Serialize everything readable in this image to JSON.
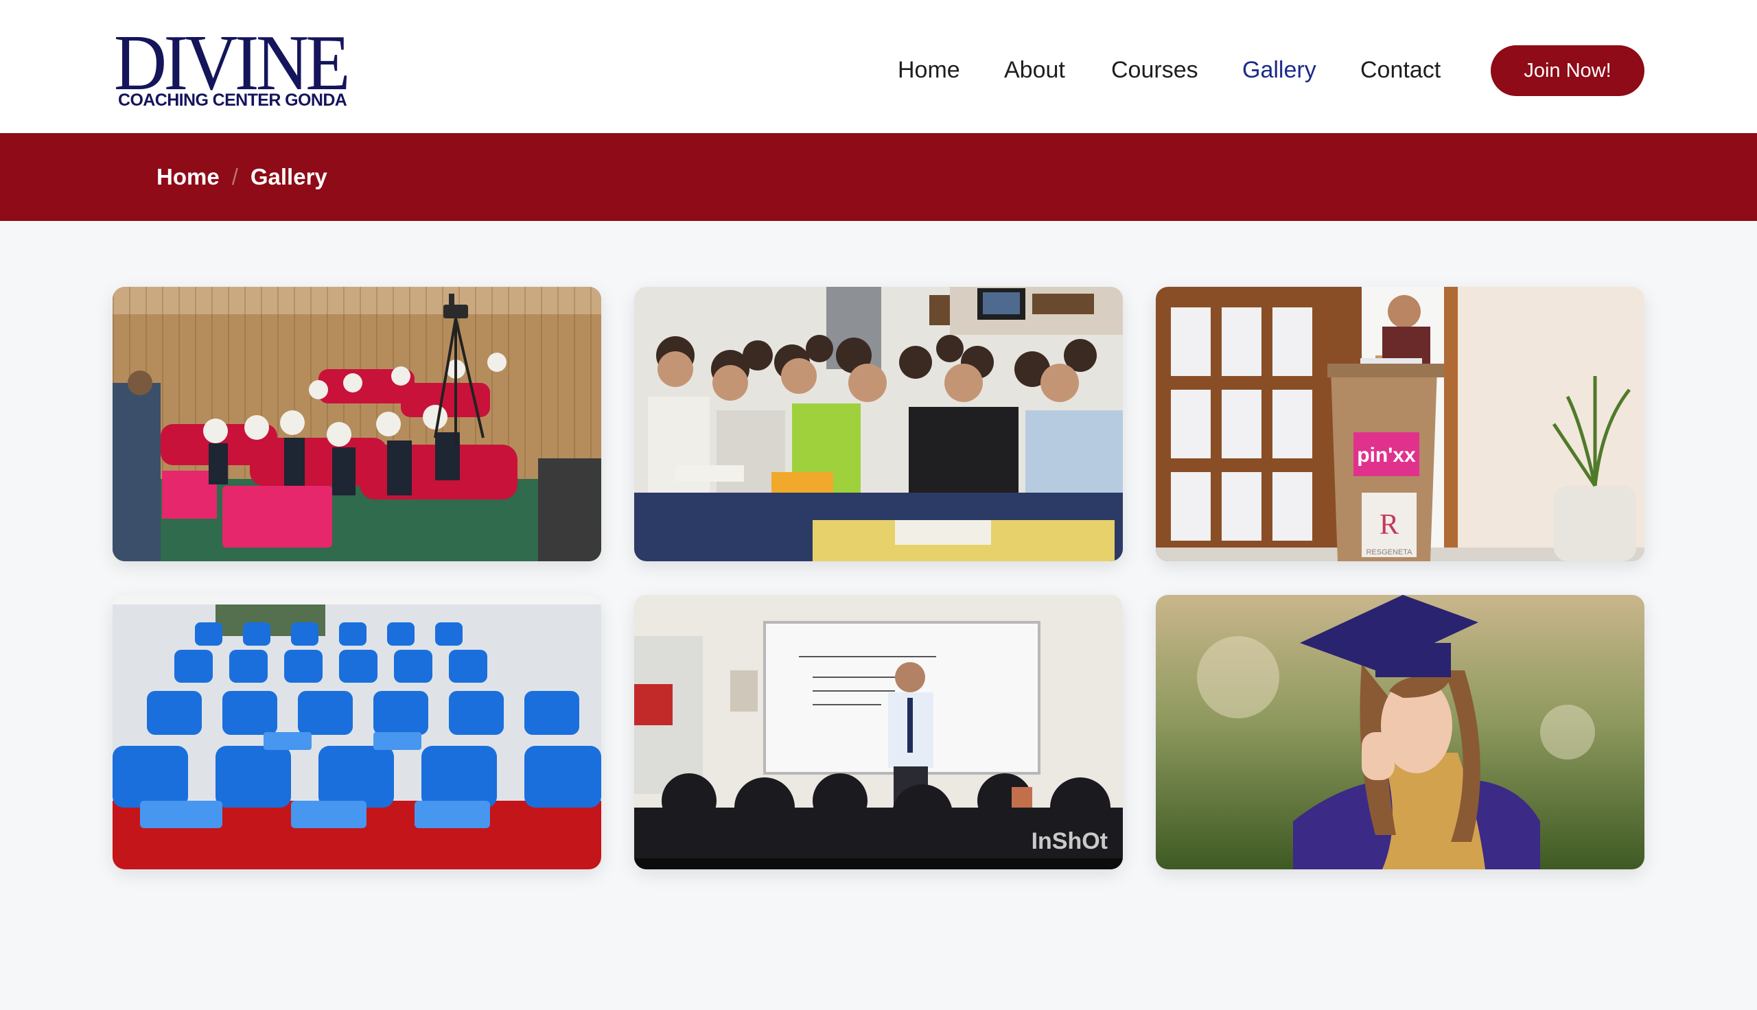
{
  "logo": {
    "title": "DIVINE",
    "subtitle": "COACHING CENTER GONDA"
  },
  "nav": {
    "items": [
      "Home",
      "About",
      "Courses",
      "Gallery",
      "Contact"
    ],
    "active": "Gallery",
    "cta": "Join Now!"
  },
  "breadcrumb": {
    "home": "Home",
    "separator": "/",
    "current": "Gallery"
  },
  "gallery": {
    "images": [
      {
        "subject": "auditorium audience with video camera on tripod"
      },
      {
        "subject": "group of students seated in classroom"
      },
      {
        "subject": "speaker at pinxx lectern"
      },
      {
        "subject": "empty classroom with blue chairs"
      },
      {
        "subject": "teacher at whiteboard with students",
        "overlay_text": "InShOt"
      },
      {
        "subject": "graduate in cap and gown lying on grass"
      }
    ],
    "lectern_text": "pin'xx",
    "lectern_sub": "RESGENETA",
    "lectern_mark": "R"
  },
  "colors": {
    "brand_red": "#8e0b17",
    "brand_navy": "#15155c",
    "active_link": "#1a2a8a"
  }
}
